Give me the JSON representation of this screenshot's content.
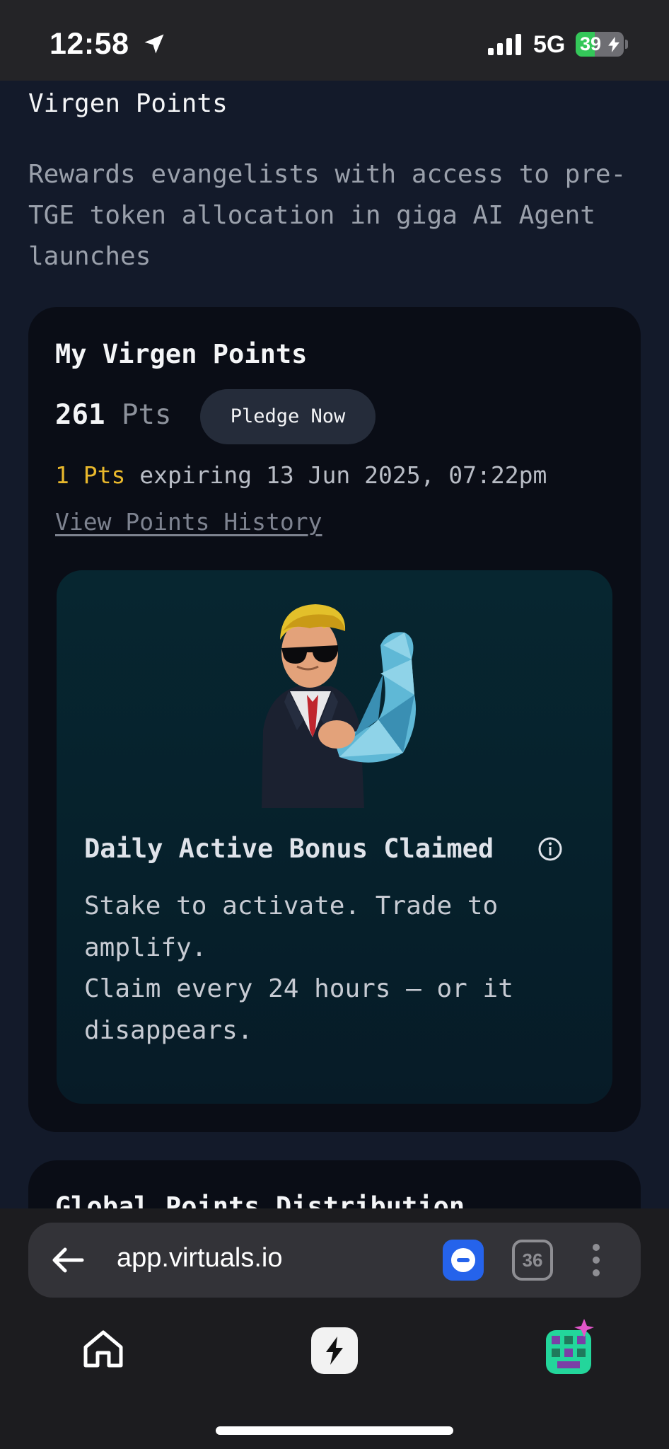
{
  "status_bar": {
    "time": "12:58",
    "network": "5G",
    "battery_level": "39",
    "battery_fraction": 0.39,
    "icons": [
      "location-arrow-icon",
      "cellular-signal-icon",
      "battery-charging-icon"
    ]
  },
  "page": {
    "title": "Virgen Points",
    "description": "Rewards evangelists with access to pre-TGE token allocation in giga AI Agent launches"
  },
  "points_card": {
    "title": "My Virgen Points",
    "points_value": "261",
    "points_unit": "Pts",
    "pledge_label": "Pledge Now",
    "expiry_amount": "1 Pts",
    "expiry_text": "expiring 13 Jun 2025, 07:22pm",
    "history_link": "View Points History"
  },
  "bonus_card": {
    "title": "Daily Active Bonus Claimed",
    "line1": "Stake to activate. Trade to amplify.",
    "line2": "Claim every 24 hours – or it disappears.",
    "mascot": "flexing-mascot-illustration",
    "info_icon": "info-icon"
  },
  "distribution_card": {
    "title": "Global Points Distribution"
  },
  "browser": {
    "url": "app.virtuals.io",
    "tab_count": "36",
    "icons": [
      "back-arrow-icon",
      "extension-icon",
      "more-vert-icon",
      "home-icon",
      "spark-icon"
    ]
  },
  "colors": {
    "page_bg": "#131a2a",
    "card_bg": "#0a0d16",
    "accent_yellow": "#e9b82c",
    "bonus_bg": "#072630",
    "extension_blue": "#2563eb",
    "battery_green": "#34c759"
  }
}
